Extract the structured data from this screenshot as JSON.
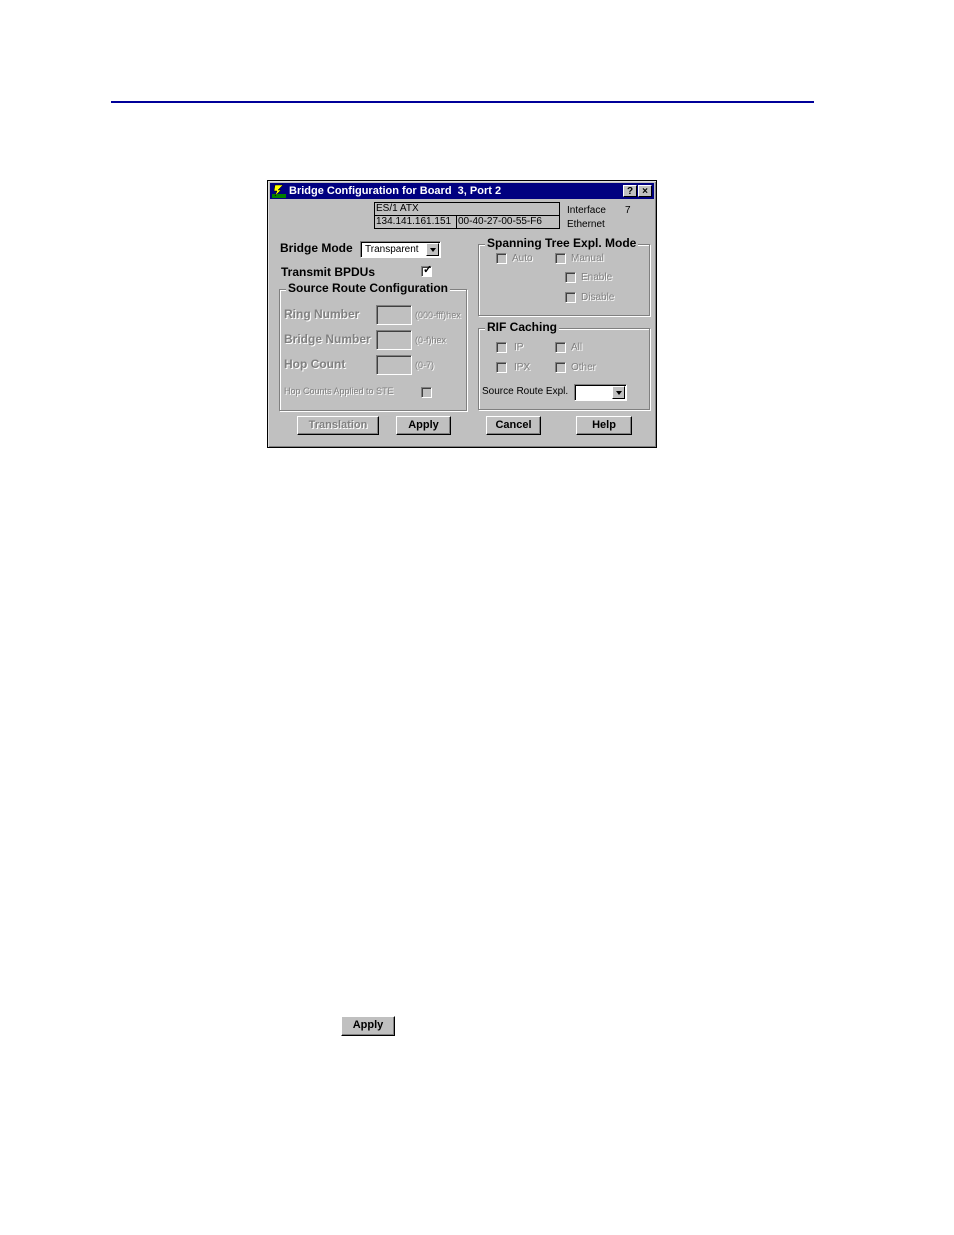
{
  "dialog": {
    "title": "Bridge Configuration for Board  3, Port 2",
    "title_buttons": {
      "help": "?",
      "close": "×"
    },
    "device_info": {
      "name": "ES/1 ATX",
      "ip_address": "134.141.161.151",
      "mac_address": "00-40-27-00-55-F6",
      "interface_label": "Interface",
      "interface_value": "7",
      "interface_type": "Ethernet"
    },
    "bridge_mode": {
      "label": "Bridge Mode",
      "value": "Transparent"
    },
    "transmit_bpdus": {
      "label": "Transmit BPDUs",
      "checked": true
    },
    "source_route_config": {
      "title": "Source Route Configuration",
      "ring_number": {
        "label": "Ring Number",
        "value": "",
        "hint": "(000-fff)hex"
      },
      "bridge_number": {
        "label": "Bridge Number",
        "value": "",
        "hint": "(0-f)hex"
      },
      "hop_count": {
        "label": "Hop Count",
        "value": "",
        "hint": "(0-7)"
      },
      "hop_counts_applied": {
        "label": "Hop Counts Applied to STE",
        "checked": false
      }
    },
    "spanning_tree": {
      "title": "Spanning Tree Expl. Mode",
      "auto": {
        "label": "Auto",
        "checked": false
      },
      "manual": {
        "label": "Manual",
        "checked": false
      },
      "enable": {
        "label": "Enable",
        "checked": false
      },
      "disable": {
        "label": "Disable",
        "checked": false
      }
    },
    "rif_caching": {
      "title": "RIF Caching",
      "ip": {
        "label": "IP",
        "checked": false
      },
      "all": {
        "label": "All",
        "checked": false
      },
      "ipx": {
        "label": "IPX",
        "checked": false
      },
      "other": {
        "label": "Other",
        "checked": false
      },
      "source_route_expl": {
        "label": "Source Route Expl.",
        "value": ""
      }
    },
    "buttons": {
      "translation": "Translation",
      "apply": "Apply",
      "cancel": "Cancel",
      "help": "Help"
    }
  },
  "standalone_apply_button": "Apply"
}
